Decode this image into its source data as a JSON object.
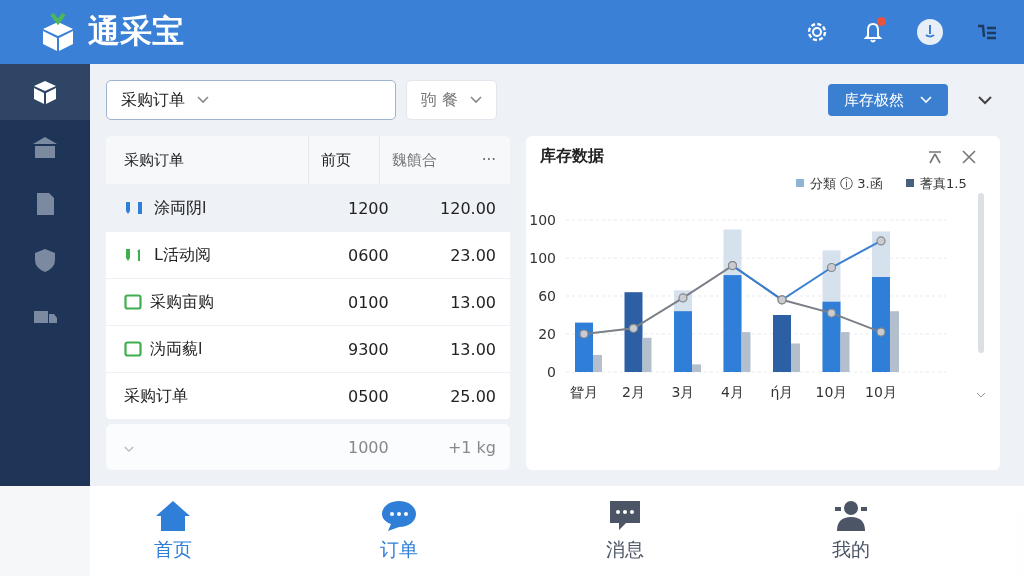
{
  "app": {
    "title": "通采宝"
  },
  "sidebar": {
    "items": [
      {
        "selected": true
      },
      {
        "selected": false
      },
      {
        "selected": false
      },
      {
        "selected": false
      },
      {
        "selected": false
      }
    ]
  },
  "toolbar": {
    "order_dropdown": "采购订单",
    "filter_dropdown": "驹 餐",
    "stock_button": "库存极然"
  },
  "table": {
    "columns": [
      "采购订单",
      "前页",
      "魏饙合",
      "···"
    ],
    "rows": [
      {
        "kind": "pair",
        "color": "#2f7fd8",
        "name": "涂両阴l",
        "col_2": "1200",
        "col_3": "120.00",
        "selected": true
      },
      {
        "kind": "flag",
        "color": "#3fae4f",
        "name": "L活动阅",
        "col_2": "0600",
        "col_3": "23.00",
        "selected": false
      },
      {
        "kind": "square",
        "color": "#3fae4f",
        "name": "采购亩购",
        "col_2": "0100",
        "col_3": "13.00",
        "selected": false
      },
      {
        "kind": "square",
        "color": "#3fae4f",
        "name": "沩両藐l",
        "col_2": "9300",
        "col_3": "13.00",
        "selected": false
      },
      {
        "kind": "plain",
        "name": "采购订单",
        "col_2": "0500",
        "col_3": "25.00",
        "selected": false
      }
    ],
    "faded_row": {
      "col_2": "1000",
      "col_3": "+1 kg"
    }
  },
  "chart_panel": {
    "title": "库存数据",
    "legend": [
      "分類 ⓘ 3.函",
      "蓍真1.5"
    ],
    "y_axis_labels": [
      "100",
      "100",
      "60",
      "20",
      "0"
    ],
    "x_axis_labels": [
      "眢月",
      "2月",
      "3月",
      "4月",
      "ή月",
      "10月",
      "10月"
    ]
  },
  "bottom_nav": [
    {
      "label": "首页",
      "selected": true
    },
    {
      "label": "订单",
      "selected": true
    },
    {
      "label": "消息",
      "selected": false
    },
    {
      "label": "我的",
      "selected": false
    }
  ]
}
